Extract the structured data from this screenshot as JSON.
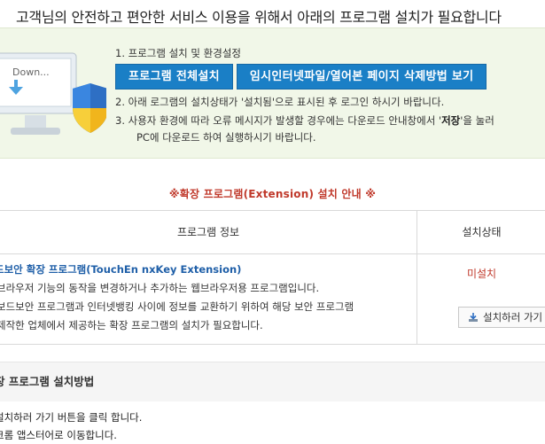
{
  "header": {
    "headline": "고객님의 안전하고 편안한 서비스 이용을 위해서 아래의 프로그램 설치가 필요합니다"
  },
  "banner": {
    "monitor_text": "Down...",
    "step1": "1. 프로그램 설치 및 환경설정",
    "buttons": {
      "install_all": "프로그램 전체설치",
      "temp_files": "임시인터넷파일/열어본 페이지 삭제방법 보기"
    },
    "step2": "2. 아래 로그램의 설치상태가 '설치됨'으로 표시된 후 로그인 하시기 바랍니다.",
    "step3_pre": "3. 사용자 환경에 따라 오류 메시지가 발생할 경우에는 다운로드 안내창에서 '",
    "step3_bold": "저장",
    "step3_post": "'을 눌러",
    "step3_line2": "PC에 다운로드 하여 실행하시기 바랍니다."
  },
  "notice": "※확장 프로그램(Extension) 설치 안내 ※",
  "table": {
    "headers": {
      "info": "프로그램 정보",
      "status": "설치상태"
    },
    "row": {
      "name": "드보안 확장 프로그램(TouchEn nxKey Extension)",
      "desc": [
        "브라우저 기능의 동작을 변경하거나 추가하는 웹브라우저용 프로그램입니다.",
        "보드보안 프로그램과 인터넷뱅킹 사이에 정보를 교환하기 위하여 해당 보안 프로그램",
        "제작한 업체에서 제공하는 확장 프로그램의 설치가 필요합니다."
      ],
      "status": "미설치",
      "install_button": "설치하러 가기"
    }
  },
  "method": {
    "title": "장 프로그램 설치방법",
    "steps": [
      "설치하러 가기 버튼을 클릭 합니다.",
      "크롬 앱스터어로 이동합니다."
    ]
  },
  "colors": {
    "accent_blue": "#1a7fc6",
    "banner_bg": "#f1f7e8",
    "warning_red": "#c0392b",
    "link_blue": "#1f5fa8"
  }
}
